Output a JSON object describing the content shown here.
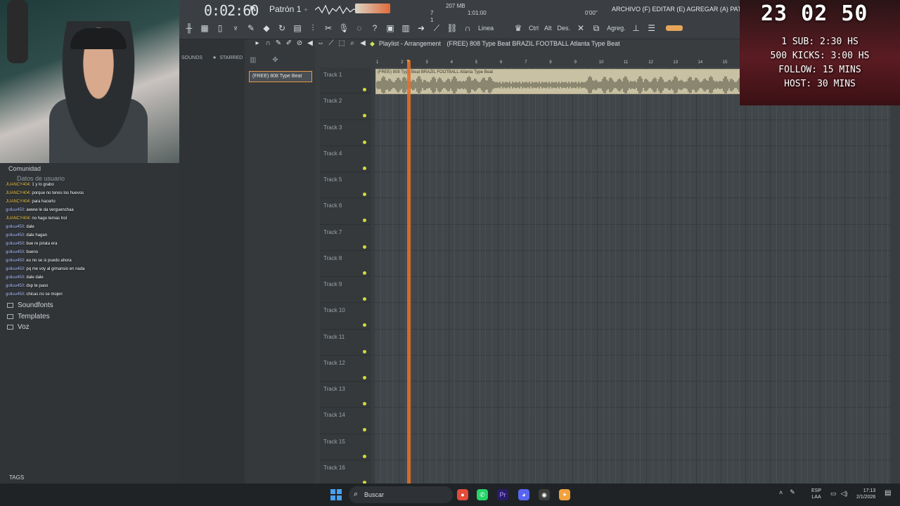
{
  "toolbar": {
    "time": "0:02:60",
    "pattern": "Patrón 1",
    "cpu_mb": "207 MB",
    "cpu_num1": "7",
    "cpu_num2": "1",
    "bar_pos": "1:01:00",
    "zero_time": "0'00\"",
    "hint": "ARCHIVO (F) EDITAR (E) AGREGAR (A) PATRONES (P) V",
    "tools": [
      "Linea",
      "Ctrl",
      "Alt",
      "Des.",
      "Agreg."
    ]
  },
  "browser": {
    "sounds_label": "SOUNDS",
    "starred_label": "STARRED",
    "items": [
      {
        "label": "Soundfonts"
      },
      {
        "label": "Templates"
      },
      {
        "label": "Voz"
      }
    ],
    "tags_label": "TAGS"
  },
  "chat": {
    "header": "Comunidad",
    "ghost": "Datos de usuario",
    "lines": [
      {
        "user": "JUANCY404",
        "text": "1 y lo grabo"
      },
      {
        "user": "JUANCY404",
        "text": "porque no tenes los huevos"
      },
      {
        "user": "JUANCY404",
        "text": "para hacerlo"
      },
      {
        "user": "goliuu450",
        "text": "awww le da verguenchaa"
      },
      {
        "user": "JUANCY404",
        "text": "no hago temas trol"
      },
      {
        "user": "goliuu450",
        "text": "dale"
      },
      {
        "user": "goliuu450",
        "text": "dale hagan"
      },
      {
        "user": "goliuu450",
        "text": "bue re pirata era"
      },
      {
        "user": "goliuu450",
        "text": "bueno"
      },
      {
        "user": "goliuu450",
        "text": "eu no se si puedo ahora"
      },
      {
        "user": "goliuu450",
        "text": "pq me voy al gimansio en nada"
      },
      {
        "user": "goliuu450",
        "text": "dale dale"
      },
      {
        "user": "goliuu450",
        "text": "dsp te paso"
      },
      {
        "user": "goliuu450",
        "text": "chicas no se mojen"
      }
    ]
  },
  "pattern_item": "(FREE) 808 Type Beat",
  "playlist": {
    "title": "Playlist - Arrangement",
    "breadcrumb": "(FREE) 808 Type Beat BRAZIL FOOTBALL Atlanta Type Beat",
    "clip_title": "(FREE) 808 Type Beat BRAZIL FOOTBALL Atlanta Type Beat",
    "ruler": [
      "1",
      "2",
      "3",
      "4",
      "5",
      "6",
      "7",
      "8",
      "9",
      "10",
      "11",
      "12",
      "13",
      "14",
      "15"
    ],
    "tracks": [
      "Track 1",
      "Track 2",
      "Track 3",
      "Track 4",
      "Track 5",
      "Track 6",
      "Track 7",
      "Track 8",
      "Track 9",
      "Track 10",
      "Track 11",
      "Track 12",
      "Track 13",
      "Track 14",
      "Track 15",
      "Track 16"
    ]
  },
  "overlay": {
    "timer": "23 02 50",
    "lines": [
      "1 SUB: 2:30 HS",
      "500 KICKS: 3:00 HS",
      "FOLLOW: 15 MINS",
      "HOST: 30 MINS"
    ]
  },
  "taskbar": {
    "search": "Buscar",
    "lang_top": "ESP",
    "lang_bottom": "LAA",
    "time": "17:13",
    "date": "2/1/2026"
  },
  "colors": {
    "accent": "#e2702a",
    "clip": "#c9c1a3",
    "track_dot": "#d2db3a"
  }
}
